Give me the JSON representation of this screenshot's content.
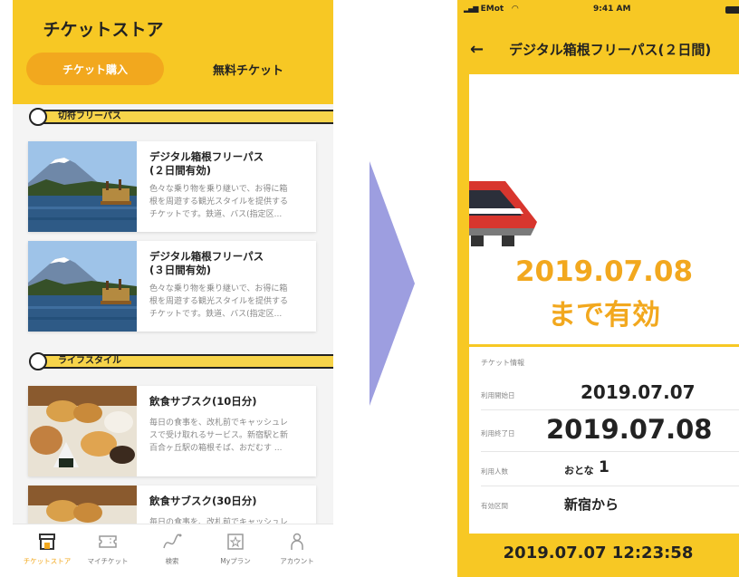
{
  "left": {
    "title": "チケットストア",
    "tabs": {
      "purchase": "チケット購入",
      "free": "無料チケット"
    },
    "sections": [
      {
        "label": "切符フリーパス",
        "cards": [
          {
            "title": "デジタル箱根フリーパス\n(２日間有効)",
            "desc": [
              "色々な乗り物を乗り継いで、お得に箱",
              "根を周遊する観光スタイルを提供する",
              "チケットです。鉄道、バス(指定区..."
            ]
          },
          {
            "title": "デジタル箱根フリーパス\n(３日間有効)",
            "desc": [
              "色々な乗り物を乗り継いで、お得に箱",
              "根を周遊する観光スタイルを提供する",
              "チケットです。鉄道、バス(指定区..."
            ]
          }
        ]
      },
      {
        "label": "ライフスタイル",
        "cards": [
          {
            "title": "飲食サブスク(10日分)",
            "desc": [
              "毎日の食事を、改札前でキャッシュレ",
              "スで受け取れるサービス。新宿駅と新",
              "百合ヶ丘駅の箱根そば、おだむす ..."
            ]
          },
          {
            "title": "飲食サブスク(30日分)",
            "desc": [
              "毎日の食事を、改札前でキャッシュレ"
            ]
          }
        ]
      }
    ],
    "nav": [
      {
        "label": "チケットストア",
        "icon": "store-icon"
      },
      {
        "label": "マイチケット",
        "icon": "ticket-icon"
      },
      {
        "label": "検索",
        "icon": "route-icon"
      },
      {
        "label": "Myプラン",
        "icon": "star-icon"
      },
      {
        "label": "アカウント",
        "icon": "person-icon"
      }
    ]
  },
  "right": {
    "status": {
      "carrier": "EMot",
      "time": "9:41 AM"
    },
    "title": "デジタル箱根フリーパス(２日間)",
    "valid_date": "2019.07.08",
    "valid_label": "まで有効",
    "info": {
      "heading": "チケット情報",
      "rows": [
        {
          "label": "利用開始日",
          "value": "2019.07.07"
        },
        {
          "label": "利用終了日",
          "value": "2019.07.08"
        },
        {
          "label": "利用人数",
          "value": "おとな",
          "count": "1"
        },
        {
          "label": "有効区間",
          "value": "新宿から"
        }
      ]
    },
    "timestamp": "2019.07.07 12:23:58"
  },
  "colors": {
    "accent_yellow": "#f7c824",
    "accent_orange": "#f2a81e",
    "arrow": "#9d9ee0"
  }
}
